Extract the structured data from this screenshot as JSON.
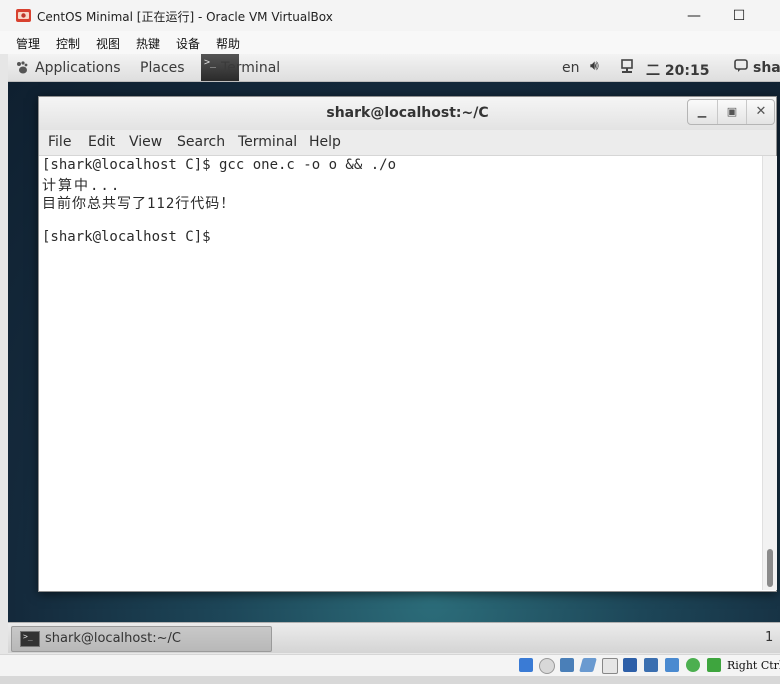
{
  "host_window": {
    "title": "CentOS Minimal [正在运行] - Oracle VM VirtualBox",
    "minimize_glyph": "—",
    "maximize_glyph": "☐",
    "menu": [
      "管理",
      "控制",
      "视图",
      "热键",
      "设备",
      "帮助"
    ]
  },
  "guest_topbar": {
    "applications": "Applications",
    "places": "Places",
    "active_app": "Terminal",
    "keyboard_layout": "en",
    "clock": "二 20:15",
    "user": "shar"
  },
  "terminal": {
    "title": "shark@localhost:~/C",
    "menu": [
      "File",
      "Edit",
      "View",
      "Search",
      "Terminal",
      "Help"
    ],
    "lines": [
      "[shark@localhost C]$ gcc one.c -o o && ./o",
      "计算中...",
      "目前你总共写了112行代码！",
      "",
      "[shark@localhost C]$"
    ]
  },
  "taskbar": {
    "task_label": "shark@localhost:~/C",
    "workspace": "1"
  },
  "vbox_statusbar": {
    "host_key": "Right Ctrl"
  },
  "colors": {
    "desktop": "#1d4658",
    "accent_red": "#d8412f"
  }
}
